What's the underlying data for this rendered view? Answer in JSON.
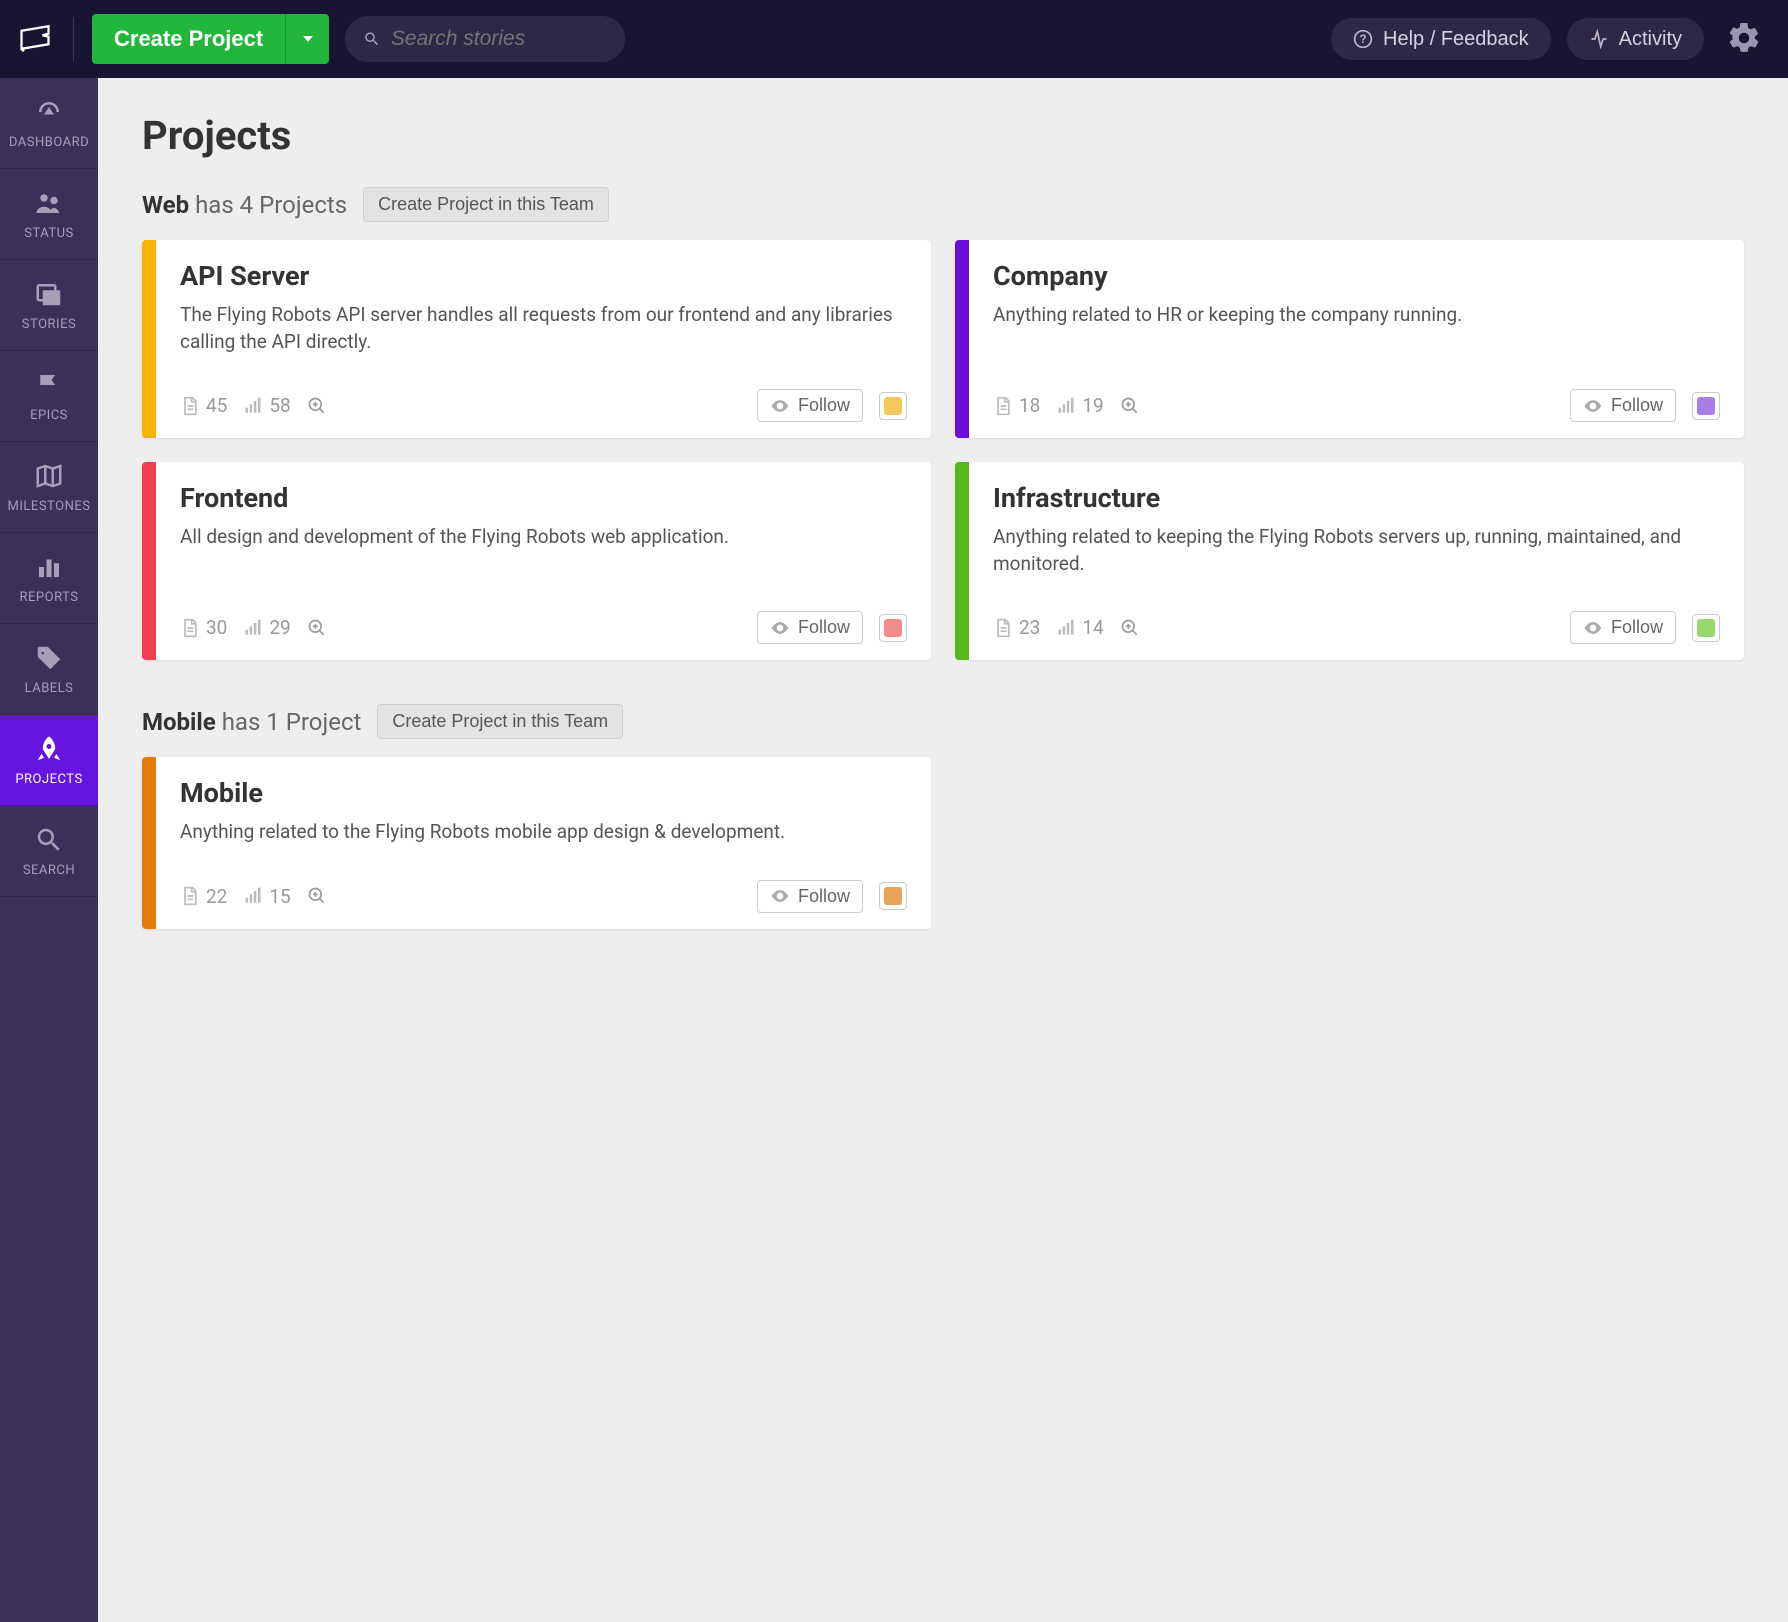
{
  "header": {
    "create_project_label": "Create Project",
    "search_placeholder": "Search stories",
    "help_label": "Help / Feedback",
    "activity_label": "Activity"
  },
  "sidebar": {
    "items": [
      {
        "label": "DASHBOARD",
        "icon": "gauge"
      },
      {
        "label": "STATUS",
        "icon": "people"
      },
      {
        "label": "STORIES",
        "icon": "stories"
      },
      {
        "label": "EPICS",
        "icon": "flag"
      },
      {
        "label": "MILESTONES",
        "icon": "map"
      },
      {
        "label": "REPORTS",
        "icon": "bar"
      },
      {
        "label": "LABELS",
        "icon": "tag"
      },
      {
        "label": "PROJECTS",
        "icon": "rocket",
        "active": true
      },
      {
        "label": "SEARCH",
        "icon": "search"
      }
    ]
  },
  "page": {
    "title": "Projects"
  },
  "follow_label": "Follow",
  "teams": [
    {
      "name": "Web",
      "count_text": "has 4 Projects",
      "create_label": "Create Project in this Team",
      "projects": [
        {
          "title": "API Server",
          "desc": "The Flying Robots API server handles all requests from our frontend and any libraries calling the API directly.",
          "stories": 45,
          "points": 58,
          "stripe": "#f5b400",
          "chip": "#f5c85a"
        },
        {
          "title": "Company",
          "desc": "Anything related to HR or keeping the company running.",
          "stories": 18,
          "points": 19,
          "stripe": "#6a0dd6",
          "chip": "#a87de6"
        },
        {
          "title": "Frontend",
          "desc": "All design and development of the Flying Robots web application.",
          "stories": 30,
          "points": 29,
          "stripe": "#f03e52",
          "chip": "#f28b8b"
        },
        {
          "title": "Infrastructure",
          "desc": "Anything related to keeping the Flying Robots servers up, running, maintained, and monitored.",
          "stories": 23,
          "points": 14,
          "stripe": "#54b81e",
          "chip": "#97d96f"
        }
      ]
    },
    {
      "name": "Mobile",
      "count_text": "has 1 Project",
      "create_label": "Create Project in this Team",
      "projects": [
        {
          "title": "Mobile",
          "desc": "Anything related to the Flying Robots mobile app design & development.",
          "stories": 22,
          "points": 15,
          "stripe": "#e27b0b",
          "chip": "#e6a55a"
        }
      ]
    }
  ]
}
